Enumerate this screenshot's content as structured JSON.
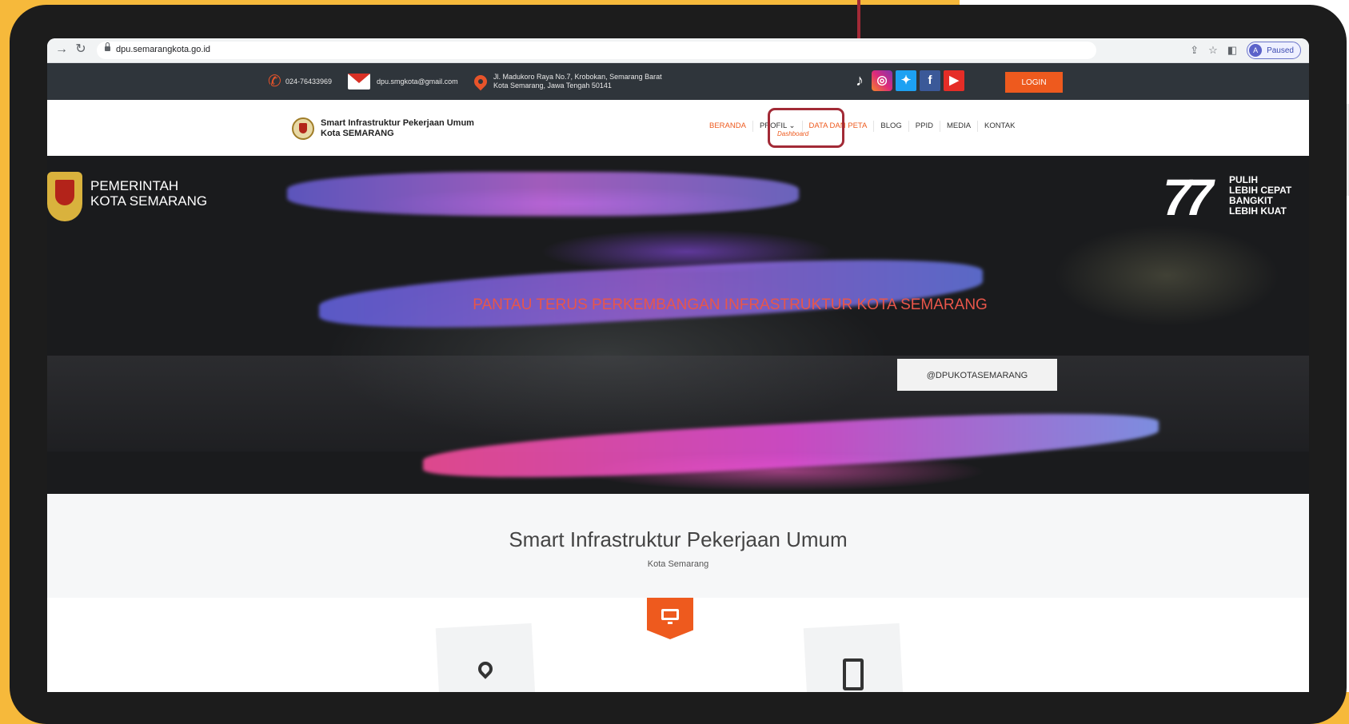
{
  "browser": {
    "url": "dpu.semarangkota.go.id",
    "paused_label": "Paused",
    "avatar_letter": "A"
  },
  "topbar": {
    "phone": "024-76433969",
    "email": "dpu.smgkota@gmail.com",
    "address_line1": "Jl. Madukoro Raya No.7, Krobokan, Semarang Barat",
    "address_line2": "Kota Semarang, Jawa Tengah 50141",
    "social_icons": [
      "tiktok-icon",
      "instagram-icon",
      "twitter-icon",
      "facebook-icon",
      "youtube-icon"
    ],
    "login_label": "LOGIN"
  },
  "header": {
    "logo_line1": "Smart Infrastruktur Pekerjaan Umum",
    "logo_line2": "Kota SEMARANG",
    "nav": [
      {
        "label": "BERANDA"
      },
      {
        "label": "PROFIL ⌄"
      },
      {
        "label": "DATA DAN PETA"
      },
      {
        "label": "BLOG"
      },
      {
        "label": "PPID"
      },
      {
        "label": "MEDIA"
      },
      {
        "label": "KONTAK"
      }
    ],
    "submenu_label": "Dashboard"
  },
  "hero": {
    "gov_line1": "PEMERINTAH",
    "gov_line2": "KOTA SEMARANG",
    "anniv_number": "77",
    "anniv_line1": "PULIH",
    "anniv_line2": "LEBIH CEPAT",
    "anniv_line3": "BANGKIT",
    "anniv_line4": "LEBIH KUAT",
    "tagline": "PANTAU TERUS PERKEMBANGAN INFRASTRUKTUR KOTA SEMARANG",
    "button_label": "@DPUKOTASEMARANG"
  },
  "intro": {
    "title": "Smart Infrastruktur Pekerjaan Umum",
    "subtitle": "Kota Semarang"
  },
  "colors": {
    "accent": "#ee5a1e",
    "highlight": "#a22a36",
    "background": "#f6b93b"
  }
}
